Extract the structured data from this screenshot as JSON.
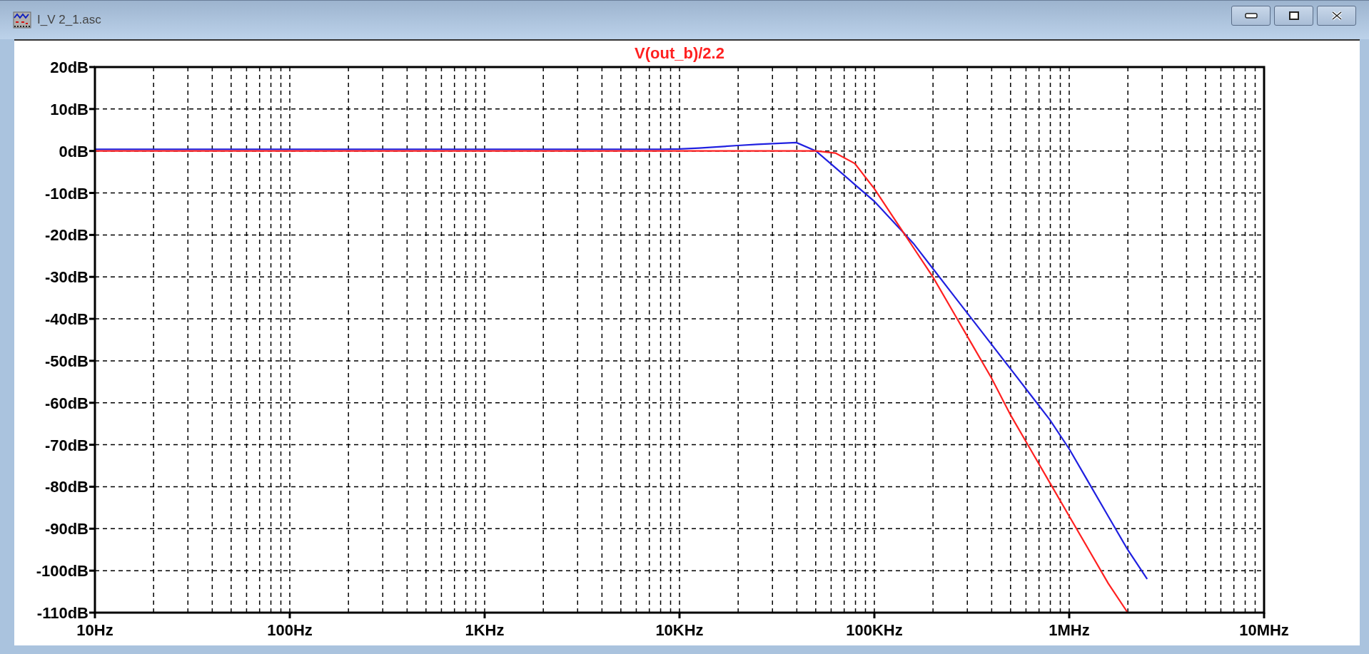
{
  "window": {
    "title": "I_V 2_1.asc"
  },
  "plot": {
    "chart_data": {
      "type": "line",
      "categories": [
        "10Hz",
        null,
        null,
        null,
        null,
        null,
        null,
        null,
        null,
        null,
        "100Hz",
        null,
        null,
        null,
        null,
        null,
        null,
        null,
        null,
        null,
        "1KHz",
        null,
        null,
        null,
        null,
        null,
        null,
        null,
        null,
        null,
        "10KHz",
        null,
        null,
        null,
        null,
        null,
        null,
        null,
        null,
        null,
        "100KHz",
        null,
        null,
        null,
        null,
        null,
        null,
        null,
        null,
        null,
        "1MHz",
        null,
        null,
        null,
        null,
        null,
        null,
        null,
        null,
        null,
        "10MHz"
      ],
      "series": [
        {
          "name": "V(out_b)/2.2",
          "color": "#ff2020",
          "values": [
            0,
            0,
            0,
            0,
            0,
            0,
            0,
            0,
            0,
            0,
            0,
            0,
            0,
            0,
            0,
            0,
            0,
            0,
            0,
            0,
            0,
            0,
            0,
            0,
            0,
            0,
            0,
            0,
            0,
            0,
            0,
            0,
            0,
            0,
            0,
            0,
            0,
            0,
            -0.5,
            -3,
            -9,
            -16,
            -23,
            -30,
            -38,
            -46,
            -54,
            -63,
            -71,
            -79,
            -87,
            -95,
            -103,
            -110,
            null,
            null,
            null,
            null,
            null,
            null,
            null
          ]
        },
        {
          "color": "#2020e0",
          "values": [
            0.4,
            0.4,
            0.4,
            0.4,
            0.4,
            0.4,
            0.4,
            0.4,
            0.4,
            0.4,
            0.4,
            0.4,
            0.4,
            0.4,
            0.4,
            0.4,
            0.4,
            0.4,
            0.4,
            0.4,
            0.4,
            0.4,
            0.4,
            0.4,
            0.4,
            0.4,
            0.4,
            0.4,
            0.4,
            0.4,
            0.5,
            0.7,
            1,
            1.3,
            1.6,
            1.8,
            2,
            0,
            -4,
            -8,
            -12,
            -17,
            -22,
            -28,
            -34,
            -40,
            -46,
            -52,
            -58,
            -64,
            -71,
            -79,
            -87,
            -95,
            -102,
            null,
            null,
            null,
            null,
            null,
            null
          ]
        }
      ],
      "grid": true,
      "ylim": [
        -110,
        20
      ],
      "yticks": [
        {
          "value": 20,
          "label": "20dB"
        },
        {
          "value": 10,
          "label": "10dB"
        },
        {
          "value": 0,
          "label": "0dB"
        },
        {
          "value": -10,
          "label": "-10dB"
        },
        {
          "value": -20,
          "label": "-20dB"
        },
        {
          "value": -30,
          "label": "-30dB"
        },
        {
          "value": -40,
          "label": "-40dB"
        },
        {
          "value": -50,
          "label": "-50dB"
        },
        {
          "value": -60,
          "label": "-60dB"
        },
        {
          "value": -70,
          "label": "-70dB"
        },
        {
          "value": -80,
          "label": "-80dB"
        },
        {
          "value": -90,
          "label": "-90dB"
        },
        {
          "value": -100,
          "label": "-100dB"
        },
        {
          "value": -110,
          "label": "-110dB"
        }
      ]
    }
  }
}
